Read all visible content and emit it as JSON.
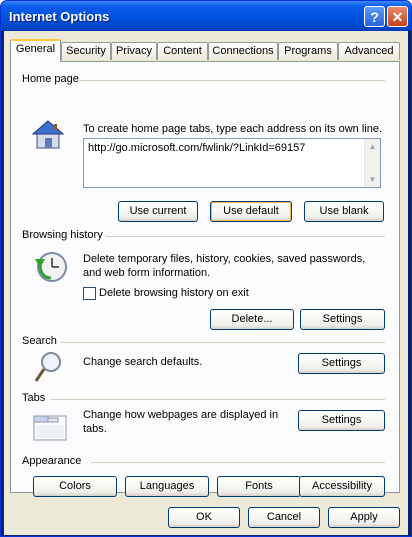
{
  "window": {
    "title": "Internet Options",
    "help_glyph": "?",
    "close_glyph": "✕"
  },
  "tabs": [
    "General",
    "Security",
    "Privacy",
    "Content",
    "Connections",
    "Programs",
    "Advanced"
  ],
  "home_page": {
    "label": "Home page",
    "description": "To create home page tabs, type each address on its own line.",
    "url": "http://go.microsoft.com/fwlink/?LinkId=69157",
    "use_current": "Use current",
    "use_default": "Use default",
    "use_blank": "Use blank"
  },
  "browsing_history": {
    "label": "Browsing history",
    "description": "Delete temporary files, history, cookies, saved passwords, and web form information.",
    "checkbox_label": "Delete browsing history on exit",
    "checkbox_checked": false,
    "delete_label": "Delete...",
    "settings_label": "Settings"
  },
  "search": {
    "label": "Search",
    "description": "Change search defaults.",
    "settings_label": "Settings"
  },
  "tabs_section": {
    "label": "Tabs",
    "description": "Change how webpages are displayed in tabs.",
    "settings_label": "Settings"
  },
  "appearance": {
    "label": "Appearance",
    "colors": "Colors",
    "languages": "Languages",
    "fonts": "Fonts",
    "accessibility": "Accessibility"
  },
  "footer": {
    "ok": "OK",
    "cancel": "Cancel",
    "apply": "Apply"
  }
}
